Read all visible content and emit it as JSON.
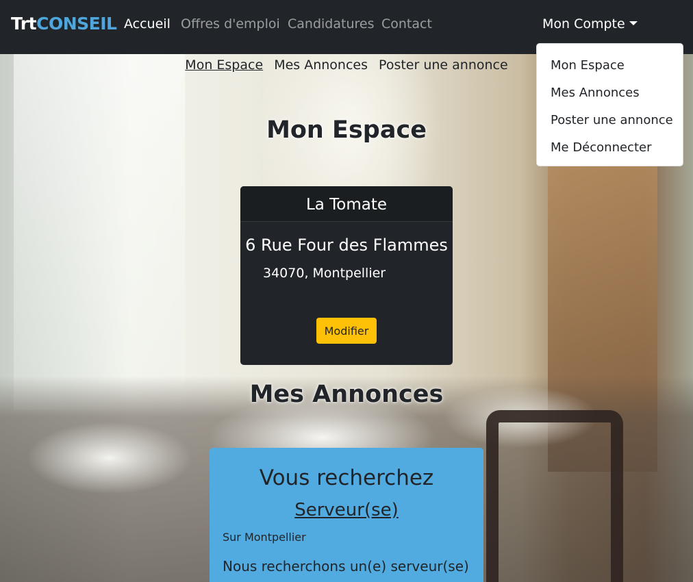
{
  "navbar": {
    "brand_part1": "Trt",
    "brand_part2": "CONSEIL",
    "links": [
      "Accueil",
      "Offres d'emploi",
      "Candidatures",
      "Contact"
    ],
    "account_label": "Mon Compte"
  },
  "account_menu": {
    "items": [
      "Mon Espace",
      "Mes Annonces",
      "Poster une annonce",
      "Me Déconnecter"
    ]
  },
  "subnav": {
    "items": [
      "Mon Espace",
      "Mes Annonces",
      "Poster une annonce"
    ]
  },
  "main": {
    "space_title": "Mon Espace",
    "company": {
      "name": "La Tomate",
      "street": "6 Rue Four des Flammes",
      "city": "34070, Montpellier",
      "modify_label": "Modifier"
    },
    "ads_title": "Mes Annonces",
    "offer": {
      "heading": "Vous recherchez",
      "job": "Serveur(se)",
      "location": "Sur Montpellier",
      "description": "Nous recherchons un(e) serveur(se)"
    }
  },
  "colors": {
    "navbar": "#212529",
    "brand_accent": "#4ea6dc",
    "modify_button": "#ffc107",
    "offer_card": "#52abe0"
  }
}
